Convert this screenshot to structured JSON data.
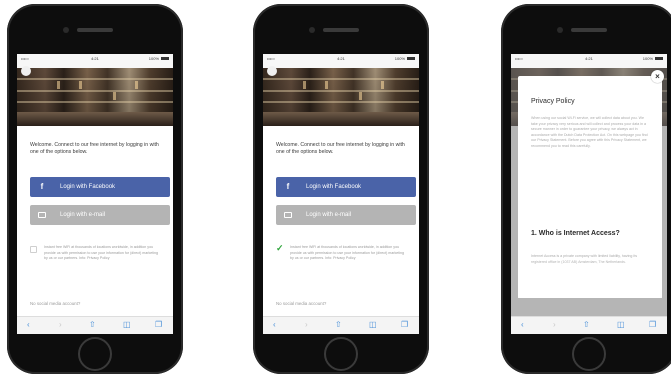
{
  "status": {
    "carrier": "••••○",
    "time": "4:21",
    "battery": "100%"
  },
  "login": {
    "welcome": "Welcome. Connect to our free internet by logging in with one of the options below.",
    "facebook_label": "Login with Facebook",
    "email_label": "Login with e-mail",
    "consent": "Instant free WiFi at thousands of locations worldwide, in addition you provide us with permission to use your information for (direct) marketing by us or our partners. Info: Privacy Policy",
    "no_account": "No social media account?"
  },
  "privacy": {
    "title": "Privacy Policy",
    "close": "×",
    "intro": "When using our social Wi-Fi service, we will collect data about you. We take your privacy very serious and will collect and process your data in a secure manner in order to guarantee your privacy, we always act in accordance with the Dutch Data Protection Act. On this webpage you find our Privacy Statement. Before you agree with this Privacy Statement, we recommend you to read this carefully.",
    "heading": "1. Who is Internet Access?",
    "body": "Internet Access is a private company with limited liability, having its registered office in (1037 AB) Amsterdam, The Netherlands."
  },
  "icons": {
    "back": "‹",
    "forward": "›",
    "share": "⇧",
    "bookmarks": "◫",
    "tabs": "❐",
    "facebook": "f",
    "check": "✓"
  },
  "colors": {
    "facebook": "#4a63a8",
    "email": "#b4b4b4",
    "check": "#2fa53c",
    "link": "#4a90d9"
  }
}
